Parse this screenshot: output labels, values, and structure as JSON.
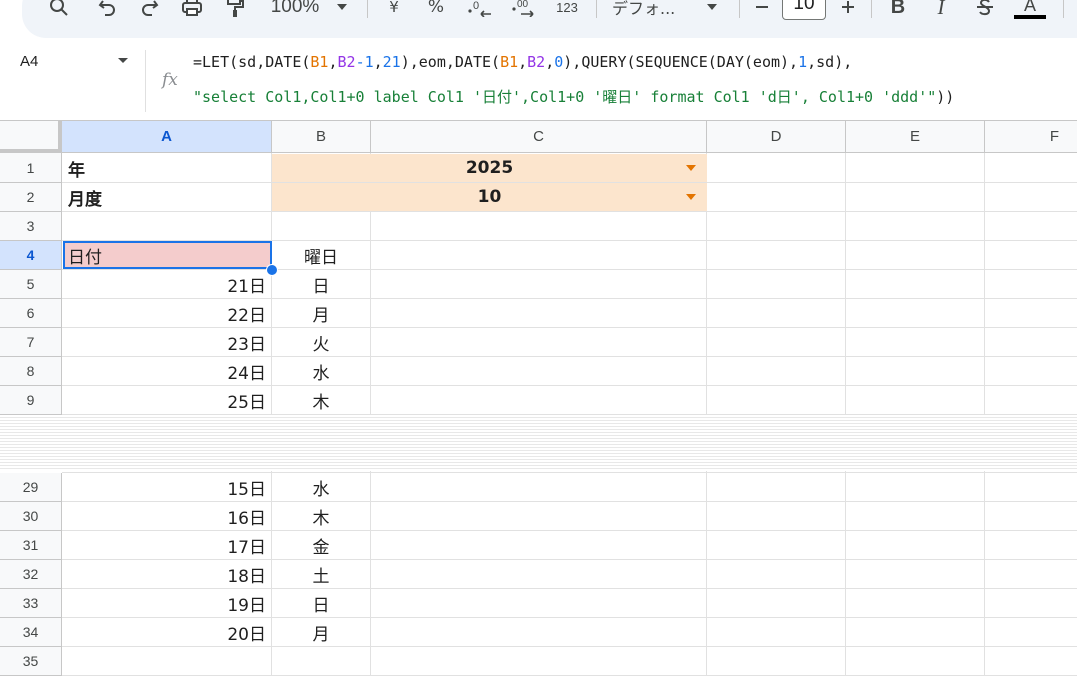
{
  "toolbar": {
    "zoom": "100%",
    "currency_symbol": "¥",
    "percent_symbol": "%",
    "number_format_label": "123",
    "font_name": "デフォ...",
    "font_size": "10",
    "text_color_letter": "A"
  },
  "formula_bar": {
    "name_box": "A4",
    "fx_label": "fx"
  },
  "columns": [
    "A",
    "B",
    "C",
    "D",
    "E",
    "F"
  ],
  "rows": [
    {
      "num": "1",
      "a": "年",
      "bc": "2025"
    },
    {
      "num": "2",
      "a": "月度",
      "bc": "10"
    },
    {
      "num": "3"
    },
    {
      "num": "4",
      "a": "日付",
      "b": "曜日"
    },
    {
      "num": "5",
      "a": "21日",
      "b": "日"
    },
    {
      "num": "6",
      "a": "22日",
      "b": "月"
    },
    {
      "num": "7",
      "a": "23日",
      "b": "火"
    },
    {
      "num": "8",
      "a": "24日",
      "b": "水"
    },
    {
      "num": "9",
      "a": "25日",
      "b": "木"
    },
    {
      "num": "29",
      "a": "15日",
      "b": "水"
    },
    {
      "num": "30",
      "a": "16日",
      "b": "木"
    },
    {
      "num": "31",
      "a": "17日",
      "b": "金"
    },
    {
      "num": "32",
      "a": "18日",
      "b": "土"
    },
    {
      "num": "33",
      "a": "19日",
      "b": "日"
    },
    {
      "num": "34",
      "a": "20日",
      "b": "月"
    },
    {
      "num": "35"
    }
  ],
  "colors": {
    "selection": "#1a73e8",
    "header_selected_bg": "#d3e3fd",
    "dropdown_cell_bg": "#fce5cd",
    "header_cell_bg": "#f4cccc",
    "dropdown_arrow": "#e37400"
  }
}
